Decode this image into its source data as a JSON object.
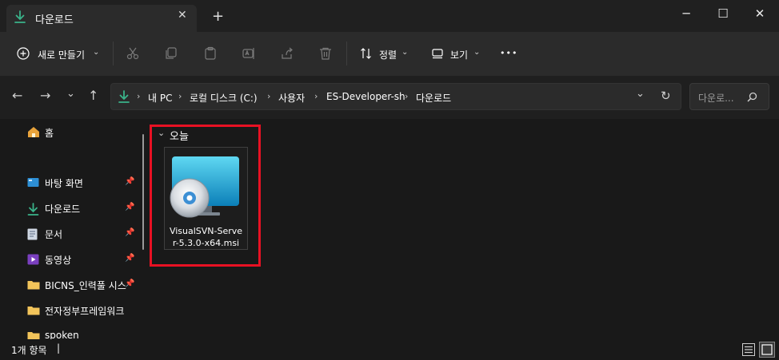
{
  "window": {
    "tab_title": "다운로드",
    "tab_close": "✕",
    "new_tab": "+",
    "minimize": "─",
    "maximize": "☐",
    "close": "✕"
  },
  "toolbar": {
    "new_label": "새로 만들기",
    "sort_label": "정렬",
    "view_label": "보기",
    "more": "•••"
  },
  "nav": {
    "back": "←",
    "forward": "→",
    "recent": "⌄",
    "up": "↑",
    "breadcrumbs": [
      "내 PC",
      "로컬 디스크 (C:)",
      "사용자",
      "ES-Developer-sh",
      "다운로드"
    ],
    "separator": "›",
    "dropdown": "⌄",
    "refresh": "↻",
    "search_placeholder": "다운로..."
  },
  "sidebar": {
    "home": "홈",
    "items": [
      {
        "label": "바탕 화면",
        "icon": "desktop-icon",
        "pinned": true
      },
      {
        "label": "다운로드",
        "icon": "download-icon",
        "pinned": true
      },
      {
        "label": "문서",
        "icon": "document-icon",
        "pinned": true
      },
      {
        "label": "동영상",
        "icon": "video-icon",
        "pinned": true
      },
      {
        "label": "BICNS_인력풀 시스",
        "icon": "folder-icon",
        "pinned": true
      },
      {
        "label": "전자정부프레임워크",
        "icon": "folder-icon",
        "pinned": false
      },
      {
        "label": "spoken",
        "icon": "folder-icon",
        "pinned": false
      }
    ]
  },
  "content": {
    "group_label": "오늘",
    "files": [
      {
        "name_line1": "VisualSVN-Serve",
        "name_line2": "r-5.3.0-x64.msi",
        "icon": "msi-installer-icon"
      }
    ]
  },
  "status": {
    "item_count": "1개 항목",
    "cursor": "|"
  },
  "colors": {
    "accent_green": "#3ab38a",
    "highlight_red": "#e81123",
    "folder_yellow": "#f2c45a"
  }
}
